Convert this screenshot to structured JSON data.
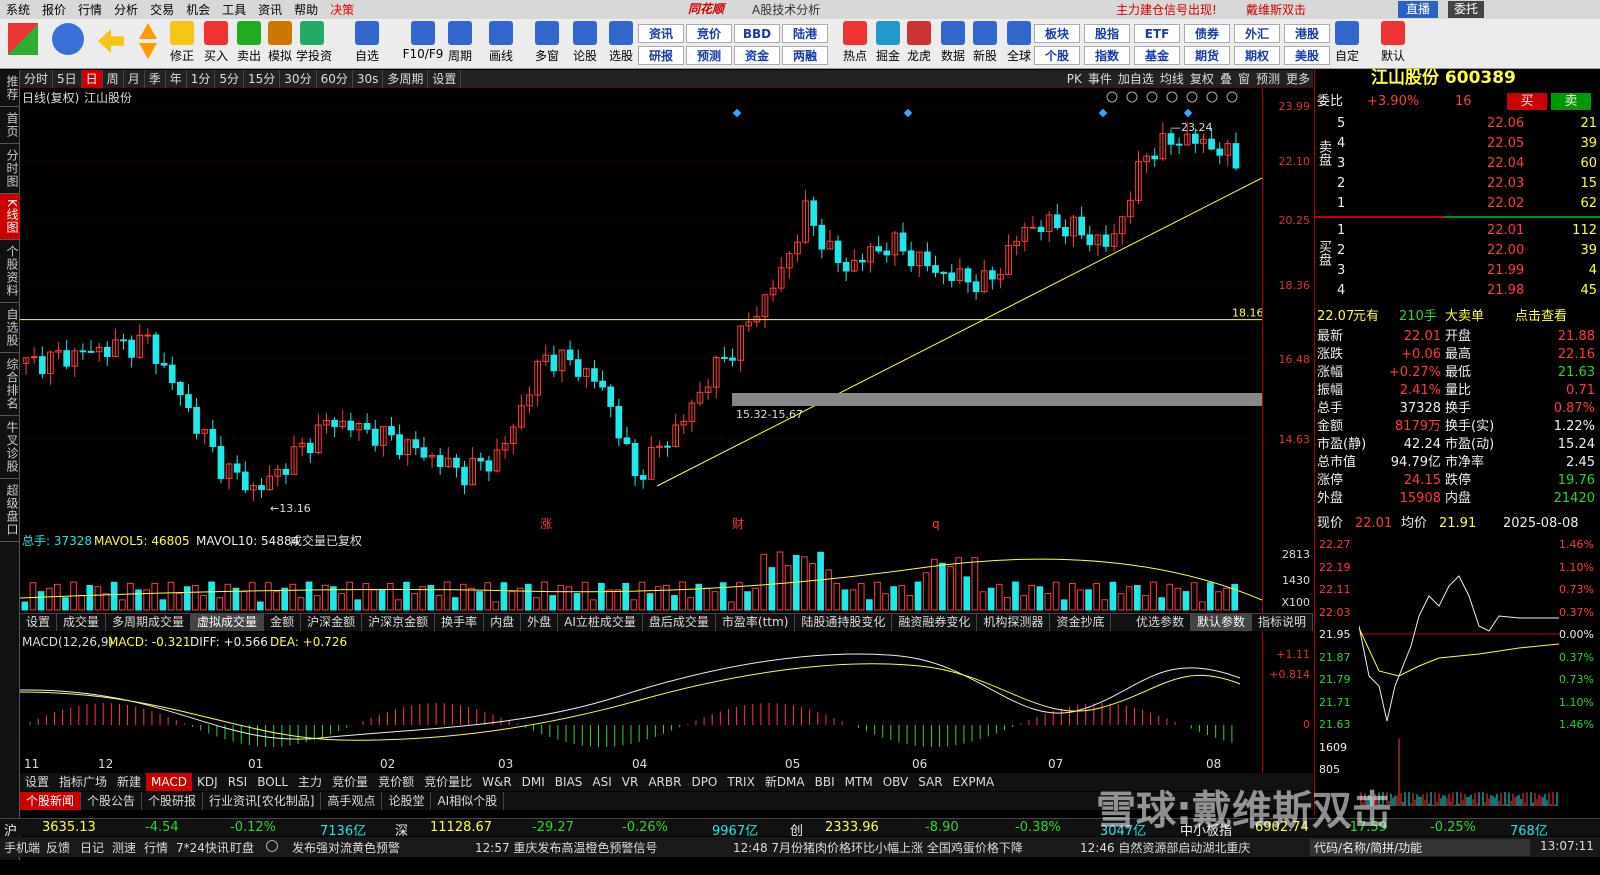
{
  "menu": {
    "items": [
      "系统",
      "报价",
      "行情",
      "分析",
      "交易",
      "机会",
      "工具",
      "资讯",
      "帮助",
      "决策"
    ],
    "brand": "同花顺",
    "subtitle": "A股技术分析",
    "signal": "主力建仓信号出现!",
    "signal_author": "戴维斯双击",
    "live": "直播",
    "trust": "委托"
  },
  "toolbar": {
    "buttons": [
      "修正",
      "买入",
      "卖出",
      "模拟",
      "学投资",
      "自选",
      "F10/F9",
      "周期",
      "画线",
      "多窗",
      "论股",
      "选股",
      "热点",
      "掘金",
      "龙虎",
      "数据",
      "新股",
      "全球",
      "自定",
      "默认"
    ],
    "tags": [
      [
        "资讯",
        "竞价",
        "BBD",
        "陆港",
        "板块",
        "股指",
        "ETF",
        "债券",
        "外汇",
        "港股"
      ],
      [
        "研报",
        "预测",
        "资金",
        "两融",
        "个股",
        "指数",
        "基金",
        "期货",
        "期权",
        "美股"
      ]
    ]
  },
  "lefttabs": [
    "推荐",
    "首页",
    "分时图",
    "K线图",
    "个股资料",
    "自选股",
    "综合排名",
    "牛叉诊股",
    "超级盘口"
  ],
  "periods": [
    "分时",
    "5日",
    "日",
    "周",
    "月",
    "季",
    "年",
    "1分",
    "5分",
    "15分",
    "30分",
    "60分",
    "30s",
    "多周期",
    "设置"
  ],
  "right_tools": [
    "PK",
    "事件",
    "加自选",
    "均线",
    "复权",
    "叠",
    "窗",
    "预测",
    "更多"
  ],
  "chart": {
    "title": "日线(复权)",
    "name": "江山股份",
    "high_label": "23.24",
    "low_label": "13.16",
    "hline_label": "18.16",
    "box_label": "15.32-15.67",
    "marks": [
      "涨",
      "财",
      "q"
    ],
    "axis": [
      "23.99",
      "22.10",
      "20.25",
      "18.36",
      "16.48",
      "14.63"
    ],
    "vol_header": {
      "t0": "总手: 37328",
      "t1": "MAVOL5: 46805",
      "t2": "MAVOL10: 54884",
      "t3": "成交量已复权"
    },
    "vol_axis": [
      "2813",
      "1430",
      "X100"
    ],
    "macd_header": {
      "t0": "MACD(12,26,9)",
      "t1": "MACD: -0.321",
      "t2": "DIFF: +0.566",
      "t3": "DEA: +0.726"
    },
    "macd_axis": [
      "+1.11",
      "+0.814",
      "0"
    ],
    "months": [
      "11",
      "12",
      "01",
      "02",
      "03",
      "04",
      "05",
      "06",
      "07",
      "08"
    ]
  },
  "chart_data": {
    "type": "candlestick",
    "symbol": "600389",
    "name": "江山股份",
    "ylim": [
      13.16,
      23.99
    ],
    "high": 23.24,
    "low": 13.16,
    "last": 22.01,
    "support_line": 18.16
  },
  "ind_tabs": [
    "设置",
    "成交量",
    "多周期成交量",
    "虚拟成交量",
    "金额",
    "沪深金额",
    "沪深京金额",
    "换手率",
    "内盘",
    "外盘",
    "AI立桩成交量",
    "盘后成交量",
    "市盈率(ttm)",
    "陆股通持股变化",
    "融资融券变化",
    "机构探测器",
    "资金抄底"
  ],
  "param_tabs": [
    "优选参数",
    "默认参数",
    "指标说明"
  ],
  "btm_tabs": [
    "设置",
    "指标广场",
    "新建",
    "MACD",
    "KDJ",
    "RSI",
    "BOLL",
    "主力",
    "竞价量",
    "竞价额",
    "竞价量比",
    "W&R",
    "DMI",
    "BIAS",
    "ASI",
    "VR",
    "ARBR",
    "DPO",
    "TRIX",
    "新DMA",
    "BBI",
    "MTM",
    "OBV",
    "SAR",
    "EXPMA"
  ],
  "news_tabs": [
    "个股新闻",
    "个股公告",
    "个股研报",
    "行业资讯[农化制品]",
    "高手观点",
    "论股堂",
    "AI相似个股"
  ],
  "quote": {
    "title": "江山股份 600389",
    "wb_label": "委比",
    "wb": "+3.90%",
    "wc": "16",
    "buy": "买",
    "sell": "卖",
    "asks": [
      [
        "5",
        "22.06",
        "21"
      ],
      [
        "4",
        "22.05",
        "39"
      ],
      [
        "3",
        "22.04",
        "60"
      ],
      [
        "2",
        "22.03",
        "15"
      ],
      [
        "1",
        "22.02",
        "62"
      ]
    ],
    "bids": [
      [
        "1",
        "22.01",
        "112"
      ],
      [
        "2",
        "22.00",
        "39"
      ],
      [
        "3",
        "21.99",
        "4"
      ],
      [
        "4",
        "21.98",
        "45"
      ]
    ],
    "ask_label": "卖盘",
    "bid_label": "买盘",
    "big": {
      "p": "22.07",
      "u": "元有",
      "q": "210手",
      "t": "大卖单",
      "c": "点击查看"
    },
    "stats": [
      [
        "最新",
        "22.01",
        "开盘",
        "21.88"
      ],
      [
        "涨跌",
        "+0.06",
        "最高",
        "22.16"
      ],
      [
        "涨幅",
        "+0.27%",
        "最低",
        "21.63"
      ],
      [
        "振幅",
        "2.41%",
        "量比",
        "0.71"
      ],
      [
        "总手",
        "37328",
        "换手",
        "0.87%"
      ],
      [
        "金额",
        "8179万",
        "换手(实)",
        "1.22%"
      ],
      [
        "市盈(静)",
        "42.24",
        "市盈(动)",
        "15.24"
      ],
      [
        "总市值",
        "94.79亿",
        "市净率",
        "2.45"
      ],
      [
        "涨停",
        "24.15",
        "跌停",
        "19.76"
      ],
      [
        "外盘",
        "15908",
        "内盘",
        "21420"
      ]
    ],
    "intraday": {
      "now_label": "现价",
      "now": "22.01",
      "avg_label": "均价",
      "avg": "21.91",
      "date": "2025-08-08",
      "laxis": [
        "22.27",
        "22.19",
        "22.11",
        "22.03",
        "21.95",
        "21.87",
        "21.79",
        "21.71",
        "21.63",
        "1609",
        "805"
      ],
      "raxis": [
        "1.46%",
        "1.10%",
        "0.73%",
        "0.37%",
        "0.00%",
        "0.37%",
        "0.73%",
        "1.10%",
        "1.46%"
      ]
    }
  },
  "ticker": {
    "sh": "沪",
    "sh_v": "3635.13",
    "sh_c": "-4.54",
    "sh_p": "-0.12%",
    "sh_a": "7136亿",
    "sz": "深",
    "sz_v": "11128.67",
    "sz_c": "-29.27",
    "sz_p": "-0.26%",
    "sz_a": "9967亿",
    "cy": "创",
    "cy_v": "2333.96",
    "cy_c": "-8.90",
    "cy_p": "-0.38%",
    "cy_a": "3047亿",
    "zx": "中小板指",
    "zx_v": "6902.74",
    "zx_c": "-17.59",
    "zx_p": "-0.25%",
    "zx_a": "768亿"
  },
  "status": {
    "items": [
      "手机端",
      "反馈",
      "日记",
      "测速",
      "行情",
      "7*24快讯",
      "盯盘"
    ],
    "n0": "发布强对流黄色预警",
    "n1": "12:57 重庆发布高温橙色预警信号",
    "n2": "12:48 7月份猪肉价格环比小幅上涨 全国鸡蛋价格下降",
    "n3": "12:46 自然资源部启动湖北重庆",
    "search": "代码/名称/简拼/功能",
    "time": "13:07:11"
  },
  "watermark": "雪球:戴维斯双击"
}
